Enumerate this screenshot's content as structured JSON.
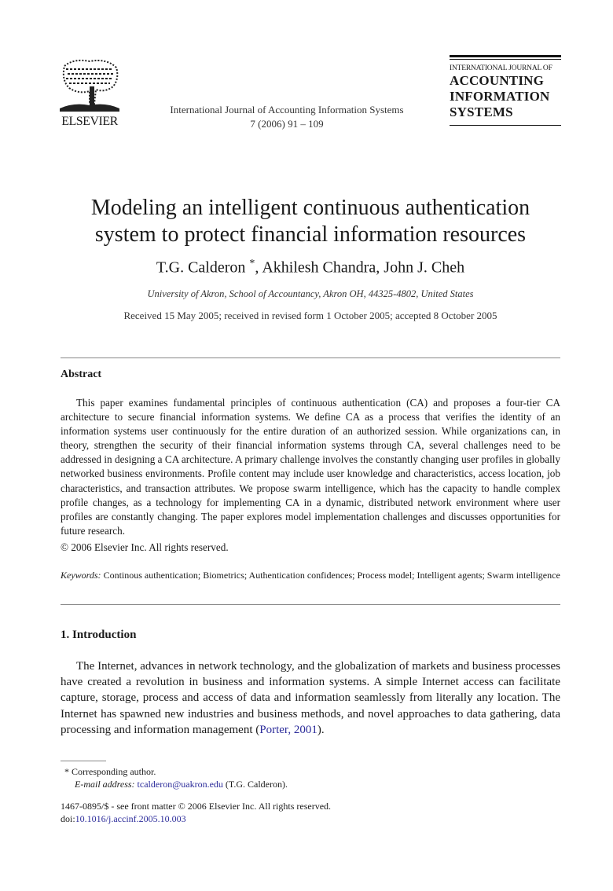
{
  "header": {
    "publisher_logo_text": "ELSEVIER",
    "journal_citation_line1": "International Journal of Accounting Information Systems",
    "journal_citation_line2": "7 (2006) 91 – 109",
    "brand_small": "INTERNATIONAL JOURNAL OF",
    "brand_line1": "ACCOUNTING",
    "brand_line2": "INFORMATION",
    "brand_line3": "SYSTEMS"
  },
  "article": {
    "title_line1": "Modeling an intelligent continuous authentication",
    "title_line2": "system to protect financial information resources",
    "authors": [
      {
        "name": "T.G. Calderon",
        "mark": "*"
      },
      {
        "name": "Akhilesh Chandra"
      },
      {
        "name": "John J. Cheh"
      }
    ],
    "author_sep": ", ",
    "affiliation": "University of Akron, School of Accountancy, Akron OH, 44325-4802, United States",
    "dates": "Received 15 May 2005; received in revised form 1 October 2005; accepted 8 October 2005"
  },
  "abstract": {
    "heading": "Abstract",
    "text": "This paper examines fundamental principles of continuous authentication (CA) and proposes a four-tier CA architecture to secure financial information systems. We define CA as a process that verifies the identity of an information systems user continuously for the entire duration of an authorized session. While organizations can, in theory, strengthen the security of their financial information systems through CA, several challenges need to be addressed in designing a CA architecture. A primary challenge involves the constantly changing user profiles in globally networked business environments. Profile content may include user knowledge and characteristics, access location, job characteristics, and transaction attributes. We propose swarm intelligence, which has the capacity to handle complex profile changes, as a technology for implementing CA in a dynamic, distributed network environment where user profiles are constantly changing. The paper explores model implementation challenges and discusses opportunities for future research.",
    "copyright": "© 2006 Elsevier Inc. All rights reserved."
  },
  "keywords": {
    "label": "Keywords:",
    "text": " Continous authentication; Biometrics; Authentication confidences; Process model; Intelligent agents; Swarm intelligence"
  },
  "introduction": {
    "heading": "1. Introduction",
    "text": "The Internet, advances in network technology, and the globalization of markets and business processes have created a revolution in business and information systems. A simple Internet access can facilitate capture, storage, process and access of data and information seamlessly from literally any location. The Internet has spawned new industries and business methods, and novel approaches to data gathering, data processing and information management (",
    "citation": "Porter, 2001",
    "after_citation": ")."
  },
  "footnote": {
    "mark": "*",
    "corresponding": " Corresponding author.",
    "email_label": "E-mail address:",
    "email": "tcalderon@uakron.edu",
    "email_suffix": " (T.G. Calderon)."
  },
  "front_matter": {
    "issn_line": "1467-0895/$ - see front matter © 2006 Elsevier Inc. All rights reserved.",
    "doi_label": "doi:",
    "doi": "10.1016/j.accinf.2005.10.003"
  },
  "colors": {
    "link": "#2b2b9a",
    "text": "#1a1a1a",
    "rule": "#888888"
  }
}
